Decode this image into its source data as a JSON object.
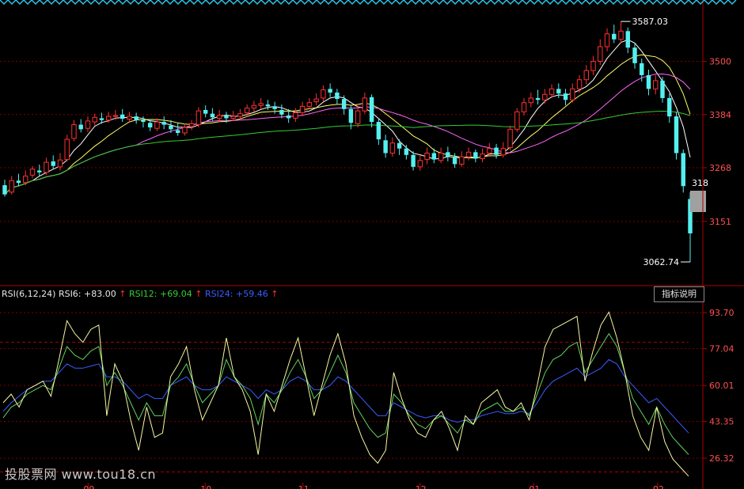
{
  "chart_data": [
    {
      "type": "candlestick",
      "title": "",
      "ylabel": "",
      "y_ticks": [
        "3151",
        "3268",
        "3384",
        "3500"
      ],
      "ylim": [
        3030,
        3620
      ],
      "annotations": {
        "high": "3587.03",
        "low": "3062.74",
        "right_edge_label": "318"
      },
      "moving_averages_colors": [
        "#ffffff",
        "#ffff66",
        "#ff66ff",
        "#33cc33"
      ],
      "candles": [
        [
          3230,
          3210,
          3242,
          3205
        ],
        [
          3215,
          3240,
          3250,
          3210
        ],
        [
          3240,
          3235,
          3255,
          3228
        ],
        [
          3236,
          3250,
          3262,
          3230
        ],
        [
          3252,
          3265,
          3272,
          3245
        ],
        [
          3262,
          3258,
          3275,
          3250
        ],
        [
          3258,
          3280,
          3290,
          3252
        ],
        [
          3282,
          3272,
          3295,
          3266
        ],
        [
          3270,
          3285,
          3300,
          3262
        ],
        [
          3286,
          3330,
          3340,
          3282
        ],
        [
          3332,
          3362,
          3372,
          3326
        ],
        [
          3362,
          3352,
          3374,
          3345
        ],
        [
          3354,
          3370,
          3380,
          3346
        ],
        [
          3368,
          3378,
          3386,
          3360
        ],
        [
          3376,
          3372,
          3388,
          3364
        ],
        [
          3372,
          3380,
          3390,
          3366
        ],
        [
          3380,
          3382,
          3394,
          3372
        ],
        [
          3384,
          3375,
          3396,
          3368
        ],
        [
          3374,
          3380,
          3390,
          3366
        ],
        [
          3380,
          3372,
          3388,
          3364
        ],
        [
          3372,
          3368,
          3380,
          3356
        ],
        [
          3366,
          3356,
          3374,
          3348
        ],
        [
          3354,
          3368,
          3376,
          3348
        ],
        [
          3368,
          3362,
          3380,
          3352
        ],
        [
          3360,
          3352,
          3372,
          3344
        ],
        [
          3350,
          3344,
          3366,
          3338
        ],
        [
          3344,
          3356,
          3364,
          3338
        ],
        [
          3358,
          3364,
          3372,
          3350
        ],
        [
          3362,
          3392,
          3400,
          3356
        ],
        [
          3394,
          3386,
          3404,
          3378
        ],
        [
          3386,
          3378,
          3398,
          3370
        ],
        [
          3376,
          3382,
          3394,
          3368
        ],
        [
          3382,
          3376,
          3390,
          3366
        ],
        [
          3376,
          3380,
          3392,
          3370
        ],
        [
          3380,
          3386,
          3396,
          3372
        ],
        [
          3388,
          3398,
          3406,
          3380
        ],
        [
          3398,
          3404,
          3414,
          3390
        ],
        [
          3404,
          3408,
          3420,
          3396
        ],
        [
          3406,
          3402,
          3416,
          3394
        ],
        [
          3402,
          3396,
          3412,
          3386
        ],
        [
          3394,
          3384,
          3406,
          3376
        ],
        [
          3382,
          3376,
          3396,
          3366
        ],
        [
          3376,
          3388,
          3398,
          3368
        ],
        [
          3388,
          3402,
          3412,
          3380
        ],
        [
          3402,
          3410,
          3420,
          3396
        ],
        [
          3412,
          3418,
          3430,
          3404
        ],
        [
          3420,
          3438,
          3448,
          3412
        ],
        [
          3440,
          3432,
          3452,
          3422
        ],
        [
          3432,
          3418,
          3440,
          3406
        ],
        [
          3418,
          3396,
          3426,
          3384
        ],
        [
          3396,
          3366,
          3404,
          3352
        ],
        [
          3364,
          3392,
          3404,
          3356
        ],
        [
          3392,
          3420,
          3432,
          3386
        ],
        [
          3422,
          3368,
          3428,
          3356
        ],
        [
          3368,
          3330,
          3376,
          3318
        ],
        [
          3328,
          3300,
          3340,
          3290
        ],
        [
          3300,
          3322,
          3334,
          3292
        ],
        [
          3322,
          3310,
          3330,
          3296
        ],
        [
          3310,
          3296,
          3318,
          3286
        ],
        [
          3296,
          3270,
          3304,
          3262
        ],
        [
          3270,
          3284,
          3296,
          3262
        ],
        [
          3286,
          3300,
          3312,
          3276
        ],
        [
          3300,
          3286,
          3310,
          3278
        ],
        [
          3284,
          3300,
          3312,
          3278
        ],
        [
          3302,
          3292,
          3314,
          3282
        ],
        [
          3292,
          3276,
          3300,
          3268
        ],
        [
          3276,
          3292,
          3304,
          3270
        ],
        [
          3292,
          3302,
          3312,
          3284
        ],
        [
          3302,
          3288,
          3308,
          3280
        ],
        [
          3288,
          3298,
          3310,
          3280
        ],
        [
          3300,
          3310,
          3322,
          3292
        ],
        [
          3312,
          3296,
          3320,
          3288
        ],
        [
          3296,
          3310,
          3324,
          3290
        ],
        [
          3312,
          3352,
          3360,
          3306
        ],
        [
          3352,
          3390,
          3398,
          3346
        ],
        [
          3390,
          3410,
          3420,
          3382
        ],
        [
          3410,
          3420,
          3432,
          3400
        ],
        [
          3420,
          3416,
          3438,
          3406
        ],
        [
          3416,
          3428,
          3440,
          3408
        ],
        [
          3428,
          3440,
          3450,
          3420
        ],
        [
          3440,
          3430,
          3452,
          3420
        ],
        [
          3430,
          3416,
          3440,
          3404
        ],
        [
          3416,
          3440,
          3452,
          3410
        ],
        [
          3440,
          3460,
          3470,
          3432
        ],
        [
          3460,
          3480,
          3492,
          3450
        ],
        [
          3480,
          3500,
          3512,
          3470
        ],
        [
          3500,
          3532,
          3548,
          3492
        ],
        [
          3532,
          3560,
          3572,
          3522
        ],
        [
          3560,
          3548,
          3580,
          3540
        ],
        [
          3548,
          3566,
          3587.03,
          3540
        ],
        [
          3566,
          3530,
          3574,
          3518
        ],
        [
          3530,
          3496,
          3540,
          3484
        ],
        [
          3496,
          3470,
          3506,
          3456
        ],
        [
          3470,
          3440,
          3482,
          3426
        ],
        [
          3440,
          3458,
          3470,
          3428
        ],
        [
          3458,
          3420,
          3466,
          3410
        ],
        [
          3420,
          3380,
          3430,
          3366
        ],
        [
          3380,
          3300,
          3390,
          3286
        ],
        [
          3300,
          3228,
          3308,
          3214
        ],
        [
          3200,
          3125,
          3215,
          3062.74
        ]
      ]
    },
    {
      "type": "line",
      "title": "RSI(6,12,24)",
      "legend": [
        {
          "name": "RSI6",
          "value": "+83.00",
          "color": "#ffffff"
        },
        {
          "name": "RSI12",
          "value": "+69.04",
          "color": "#33cc33"
        },
        {
          "name": "RSI24",
          "value": "+59.46",
          "color": "#3a5cff"
        }
      ],
      "y_ticks": [
        "93.70",
        "77.04",
        "60.01",
        "43.35",
        "26.32"
      ],
      "ylim": [
        15,
        100
      ],
      "x_ticks": [
        "09",
        "10",
        "11",
        "12",
        "01",
        "02"
      ],
      "series": [
        {
          "name": "RSI6",
          "values": [
            52,
            56,
            50,
            58,
            60,
            62,
            55,
            72,
            90,
            84,
            80,
            86,
            88,
            46,
            70,
            62,
            44,
            30,
            50,
            36,
            38,
            64,
            70,
            78,
            58,
            44,
            52,
            60,
            82,
            64,
            58,
            48,
            28,
            56,
            48,
            60,
            72,
            82,
            64,
            46,
            60,
            74,
            84,
            70,
            46,
            36,
            28,
            24,
            30,
            66,
            54,
            44,
            38,
            36,
            44,
            48,
            40,
            30,
            46,
            42,
            52,
            55,
            58,
            50,
            48,
            52,
            44,
            60,
            78,
            86,
            88,
            90,
            92,
            62,
            76,
            88,
            94,
            82,
            66,
            46,
            36,
            30,
            50,
            34,
            26,
            22,
            18
          ]
        },
        {
          "name": "RSI12",
          "values": [
            45,
            50,
            52,
            56,
            58,
            60,
            58,
            68,
            78,
            74,
            72,
            76,
            78,
            60,
            66,
            60,
            52,
            44,
            52,
            46,
            46,
            60,
            64,
            70,
            60,
            52,
            56,
            60,
            72,
            64,
            60,
            54,
            42,
            56,
            52,
            58,
            66,
            72,
            64,
            54,
            58,
            66,
            74,
            66,
            52,
            46,
            40,
            36,
            38,
            56,
            52,
            46,
            42,
            40,
            44,
            46,
            42,
            38,
            44,
            42,
            48,
            50,
            52,
            48,
            48,
            50,
            46,
            56,
            66,
            72,
            74,
            78,
            80,
            66,
            72,
            78,
            84,
            78,
            66,
            54,
            48,
            42,
            50,
            42,
            36,
            32,
            28
          ]
        },
        {
          "name": "RSI24",
          "values": [
            48,
            52,
            55,
            58,
            60,
            62,
            62,
            66,
            70,
            68,
            68,
            69,
            70,
            64,
            64,
            62,
            58,
            54,
            56,
            54,
            54,
            60,
            62,
            64,
            60,
            58,
            58,
            60,
            64,
            62,
            60,
            58,
            54,
            58,
            56,
            58,
            62,
            64,
            62,
            58,
            58,
            60,
            64,
            62,
            58,
            54,
            50,
            46,
            46,
            52,
            50,
            48,
            46,
            45,
            46,
            46,
            44,
            43,
            44,
            44,
            46,
            47,
            48,
            47,
            47,
            48,
            47,
            52,
            58,
            62,
            64,
            66,
            68,
            64,
            66,
            68,
            72,
            70,
            64,
            60,
            56,
            52,
            54,
            50,
            46,
            42,
            38
          ]
        }
      ]
    }
  ],
  "ui": {
    "indicator_button": "指标说明",
    "watermark": "投股票网 www.tou18.cn"
  }
}
